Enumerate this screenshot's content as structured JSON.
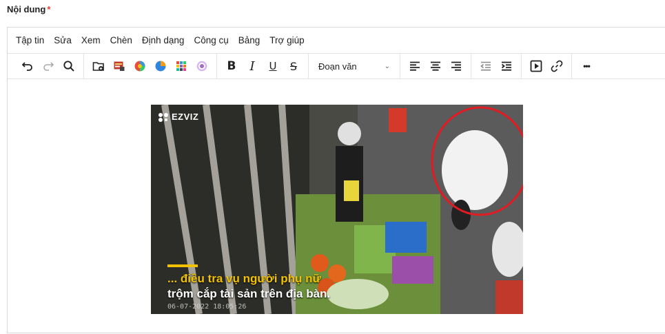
{
  "field": {
    "label": "Nội dung",
    "required_mark": "*"
  },
  "menubar": {
    "items": [
      "Tập tin",
      "Sửa",
      "Xem",
      "Chèn",
      "Định dạng",
      "Công cụ",
      "Bảng",
      "Trợ giúp"
    ]
  },
  "toolbar": {
    "icons": [
      "undo-icon",
      "redo-icon",
      "search-icon",
      "insert-media-folder-icon",
      "media-library-icon",
      "chart-icon",
      "pie-chart-icon",
      "grid-icon",
      "target-icon"
    ],
    "format": {
      "bold": "B",
      "italic": "I",
      "underline": "U",
      "strikethrough": "S"
    },
    "block_format": "Đoạn văn",
    "more": "•••"
  },
  "video": {
    "logo": "EZVIZ",
    "caption_line1": "... điều tra vụ người phụ nữ",
    "caption_line2": "trộm cắp tài sản trên địa bàn.",
    "timestamp": "06-07-2022 18:05:26",
    "highlight_color": "#e21b23",
    "caption_color": "#f2c200"
  }
}
